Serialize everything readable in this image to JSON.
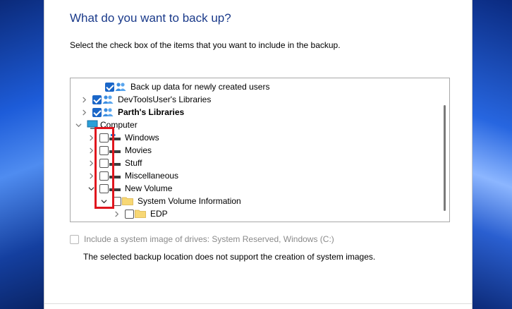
{
  "dialog": {
    "heading": "What do you want to back up?",
    "subtitle": "Select the check box of the items that you want to include in the backup."
  },
  "tree": {
    "items": [
      {
        "label": "Back up data for newly created users",
        "checked": true,
        "expander": "",
        "icon": "users-icon",
        "bold": false
      },
      {
        "label": "DevToolsUser's Libraries",
        "checked": true,
        "expander": "collapsed",
        "icon": "users-icon",
        "bold": false
      },
      {
        "label": "Parth's Libraries",
        "checked": true,
        "expander": "collapsed",
        "icon": "users-icon",
        "bold": true
      },
      {
        "label": "Computer",
        "checked": null,
        "expander": "expanded",
        "icon": "computer-icon",
        "bold": false
      },
      {
        "label": "Windows",
        "checked": false,
        "expander": "collapsed",
        "icon": "drive-icon",
        "bold": false
      },
      {
        "label": "Movies",
        "checked": false,
        "expander": "collapsed",
        "icon": "drive-icon",
        "bold": false
      },
      {
        "label": "Stuff",
        "checked": false,
        "expander": "collapsed",
        "icon": "drive-icon",
        "bold": false
      },
      {
        "label": "Miscellaneous",
        "checked": false,
        "expander": "collapsed",
        "icon": "drive-icon",
        "bold": false
      },
      {
        "label": "New Volume",
        "checked": false,
        "expander": "expanded",
        "icon": "drive-icon",
        "bold": false
      },
      {
        "label": "System Volume Information",
        "checked": false,
        "expander": "expanded",
        "icon": "folder-icon",
        "bold": false
      },
      {
        "label": "EDP",
        "checked": false,
        "expander": "collapsed",
        "icon": "folder-icon",
        "bold": false
      }
    ]
  },
  "system_image": {
    "label": "Include a system image of drives: System Reserved, Windows (C:)",
    "checked": false,
    "disabled": true
  },
  "note": "The selected backup location does not support the creation of system images.",
  "colors": {
    "heading": "#1a3a8a",
    "checkbox_checked": "#1a66c8",
    "highlight": "#e0161e"
  }
}
